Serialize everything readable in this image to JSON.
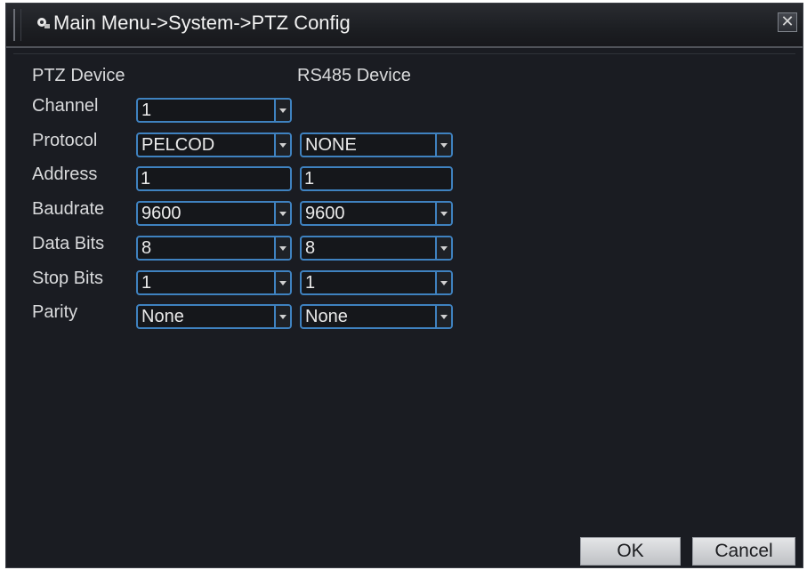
{
  "window": {
    "title": "Main Menu->System->PTZ Config",
    "close_label": "✕"
  },
  "headers": {
    "ptz": "PTZ Device",
    "rs485": "RS485 Device"
  },
  "rows": [
    {
      "label": "Channel",
      "ptz": "1",
      "rs485": null,
      "type": "select"
    },
    {
      "label": "Protocol",
      "ptz": "PELCOD",
      "rs485": "NONE",
      "type": "select"
    },
    {
      "label": "Address",
      "ptz": "1",
      "rs485": "1",
      "type": "input"
    },
    {
      "label": "Baudrate",
      "ptz": "9600",
      "rs485": "9600",
      "type": "select"
    },
    {
      "label": "Data Bits",
      "ptz": "8",
      "rs485": "8",
      "type": "select"
    },
    {
      "label": "Stop Bits",
      "ptz": "1",
      "rs485": "1",
      "type": "select"
    },
    {
      "label": "Parity",
      "ptz": "None",
      "rs485": "None",
      "type": "select"
    }
  ],
  "buttons": {
    "ok": "OK",
    "cancel": "Cancel"
  },
  "colors": {
    "background": "#1a1c22",
    "field_border": "#3f82c0",
    "text": "#d9dadc"
  }
}
